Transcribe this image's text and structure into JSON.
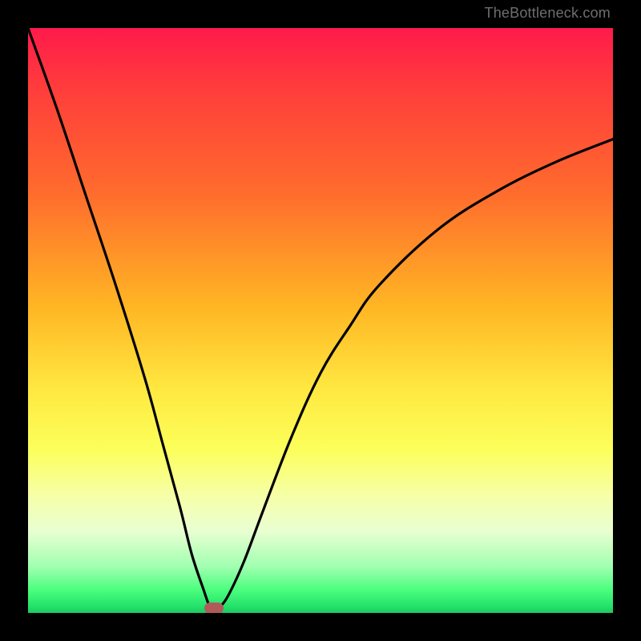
{
  "watermark": "TheBottleneck.com",
  "chart_data": {
    "type": "line",
    "title": "",
    "xlabel": "",
    "ylabel": "",
    "xlim": [
      0,
      100
    ],
    "ylim": [
      0,
      100
    ],
    "grid": false,
    "legend": false,
    "series": [
      {
        "name": "bottleneck-curve",
        "color": "#000000",
        "x": [
          0,
          5,
          10,
          15,
          20,
          23,
          26,
          28,
          30,
          31,
          31.8,
          33,
          34.5,
          37,
          40,
          45,
          50,
          55,
          60,
          70,
          80,
          90,
          100
        ],
        "y": [
          100,
          86,
          71,
          56,
          40,
          29,
          18,
          10,
          4,
          1.2,
          0.3,
          1.2,
          3.5,
          9,
          17,
          30,
          41,
          49,
          56,
          65.5,
          72,
          77,
          81
        ]
      }
    ],
    "marker": {
      "x": 31.8,
      "y": 0.8,
      "color": "#b15a5a"
    },
    "gradient_stops": [
      {
        "pct": 0,
        "color": "#ff1a4b"
      },
      {
        "pct": 10,
        "color": "#ff3c3c"
      },
      {
        "pct": 28,
        "color": "#ff6b2d"
      },
      {
        "pct": 48,
        "color": "#ffb724"
      },
      {
        "pct": 62,
        "color": "#ffe941"
      },
      {
        "pct": 72,
        "color": "#fcff5a"
      },
      {
        "pct": 80,
        "color": "#f6ffa8"
      },
      {
        "pct": 86,
        "color": "#e9ffd2"
      },
      {
        "pct": 92,
        "color": "#a2ffb1"
      },
      {
        "pct": 96,
        "color": "#4bff7e"
      },
      {
        "pct": 99,
        "color": "#22e06a"
      },
      {
        "pct": 100,
        "color": "#1cc75e"
      }
    ]
  }
}
